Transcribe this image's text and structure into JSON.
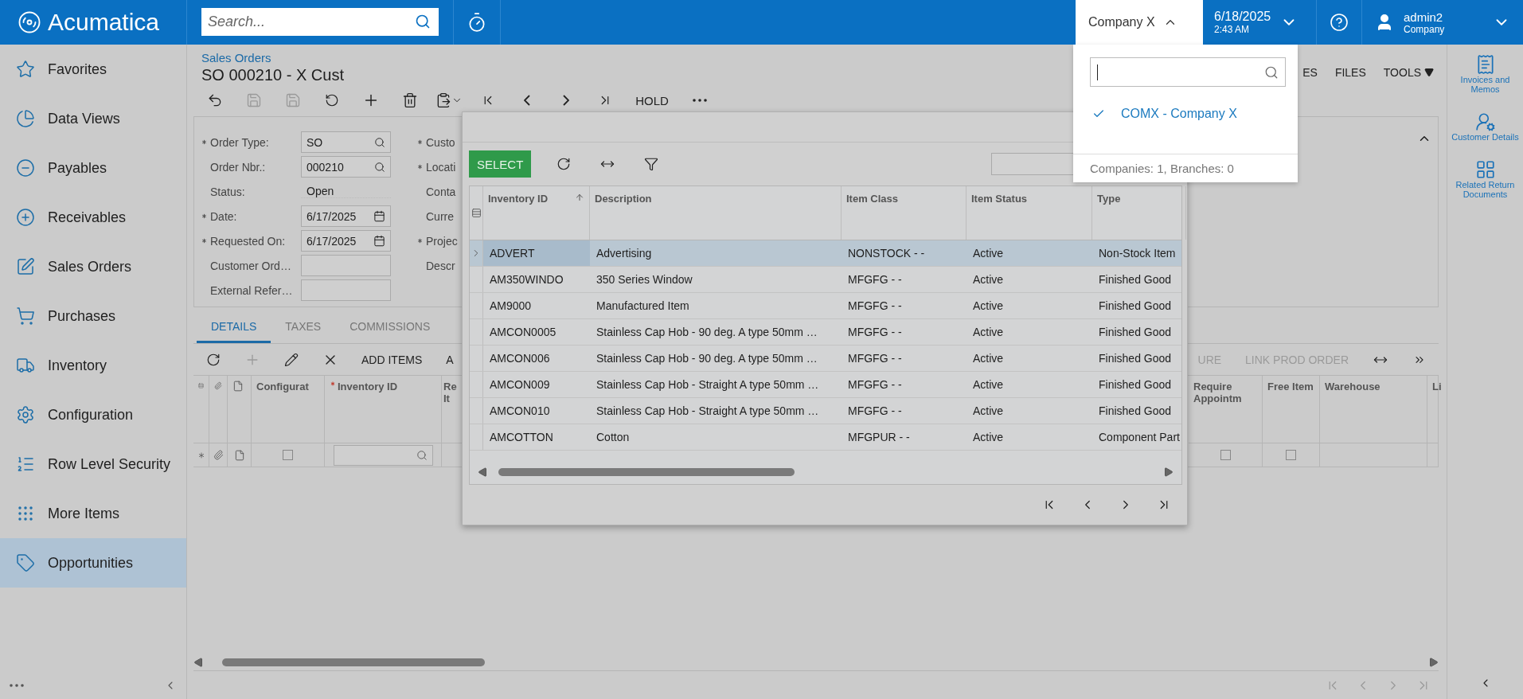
{
  "header": {
    "logo": "Acumatica",
    "search": {
      "placeholder": "Search..."
    },
    "company": {
      "label": "Company X",
      "expanded": true
    },
    "date": "6/18/2025",
    "time": "2:43 AM",
    "user": {
      "name": "admin2",
      "company": "Company"
    }
  },
  "sidebar": {
    "items": [
      {
        "label": "Favorites",
        "selected": false
      },
      {
        "label": "Data Views",
        "selected": false
      },
      {
        "label": "Payables",
        "selected": false
      },
      {
        "label": "Receivables",
        "selected": false
      },
      {
        "label": "Sales Orders",
        "selected": false
      },
      {
        "label": "Purchases",
        "selected": false
      },
      {
        "label": "Inventory",
        "selected": false
      },
      {
        "label": "Configuration",
        "selected": false
      },
      {
        "label": "Row Level Security",
        "selected": false
      },
      {
        "label": "More Items",
        "selected": false
      },
      {
        "label": "Opportunities",
        "selected": true
      }
    ]
  },
  "page": {
    "breadcrumb": "Sales Orders",
    "title": "SO 000210 - X Cust",
    "toolbar": {
      "hold": "HOLD"
    },
    "actions": [
      {
        "label": "ES",
        "kind": "plain"
      },
      {
        "label": "FILES",
        "kind": "plain"
      },
      {
        "label": "TOOLS",
        "kind": "menu"
      }
    ]
  },
  "form": {
    "fields": [
      {
        "label": "Order Type:",
        "required": true,
        "kind": "lookup",
        "value": "SO"
      },
      {
        "label": "Order Nbr.:",
        "required": false,
        "kind": "lookup",
        "value": "000210"
      },
      {
        "label": "Status:",
        "required": false,
        "kind": "text",
        "value": "Open"
      },
      {
        "label": "Date:",
        "required": true,
        "kind": "date",
        "value": "6/17/2025"
      },
      {
        "label": "Requested On:",
        "required": true,
        "kind": "date",
        "value": "6/17/2025"
      },
      {
        "label": "Customer Ord…",
        "required": false,
        "kind": "input"
      },
      {
        "label": "External Refer…",
        "required": false,
        "kind": "input"
      }
    ],
    "column_2": [
      {
        "label": "Custo",
        "required": true
      },
      {
        "label": "Locati",
        "required": true
      },
      {
        "label": "Conta",
        "required": false
      },
      {
        "label": "Curre",
        "required": false
      },
      {
        "label": "Projec",
        "required": true
      },
      {
        "label": "Descr",
        "required": false
      }
    ]
  },
  "tabs": [
    {
      "label": "DETAILS",
      "selected": true
    },
    {
      "label": "TAXES",
      "selected": false
    },
    {
      "label": "COMMISSIONS",
      "selected": false
    }
  ],
  "details": {
    "toolbar": [
      {
        "label": "ADD ITEMS",
        "disabled": false
      },
      {
        "label": "A",
        "disabled": false
      }
    ],
    "toolbar_right": [
      {
        "label": "URE",
        "disabled": true
      },
      {
        "label": "LINK PROD ORDER",
        "disabled": true
      }
    ],
    "columns_left": [
      {
        "label": "Configurat",
        "required": false
      },
      {
        "label": "Inventory ID",
        "required": true
      },
      {
        "label": "Re It",
        "required": false
      }
    ],
    "columns_right": [
      {
        "label": "Require Appointm"
      },
      {
        "label": "Free Item"
      },
      {
        "label": "Warehouse"
      },
      {
        "label": "Li"
      }
    ],
    "new_row": {
      "configurable_checked": false,
      "require_appointment_checked": false,
      "free_item_checked": false
    }
  },
  "dialog": {
    "select": "SELECT",
    "columns": [
      {
        "label": "Inventory ID",
        "sorted": true
      },
      {
        "label": "Description",
        "sorted": false
      },
      {
        "label": "Item Class",
        "sorted": false
      },
      {
        "label": "Item Status",
        "sorted": false
      },
      {
        "label": "Type",
        "sorted": false
      }
    ],
    "rows": [
      {
        "selected": true,
        "cells": [
          "ADVERT",
          "Advertising",
          "NONSTOCK - -",
          "Active",
          "Non-Stock Item"
        ]
      },
      {
        "selected": false,
        "cells": [
          "AM350WINDO",
          "350 Series Window",
          "MFGFG - -",
          "Active",
          "Finished Good"
        ]
      },
      {
        "selected": false,
        "cells": [
          "AM9000",
          "Manufactured Item",
          "MFGFG - -",
          "Active",
          "Finished Good"
        ]
      },
      {
        "selected": false,
        "cells": [
          "AMCON0005",
          "Stainless Cap Hob - 90 deg. A type 50mm …",
          "MFGFG - -",
          "Active",
          "Finished Good"
        ]
      },
      {
        "selected": false,
        "cells": [
          "AMCON006",
          "Stainless Cap Hob - 90 deg. A type 50mm …",
          "MFGFG - -",
          "Active",
          "Finished Good"
        ]
      },
      {
        "selected": false,
        "cells": [
          "AMCON009",
          "Stainless Cap Hob - Straight A type 50mm …",
          "MFGFG - -",
          "Active",
          "Finished Good"
        ]
      },
      {
        "selected": false,
        "cells": [
          "AMCON010",
          "Stainless Cap Hob - Straight A type 50mm …",
          "MFGFG - -",
          "Active",
          "Finished Good"
        ]
      },
      {
        "selected": false,
        "cells": [
          "AMCOTTON",
          "Cotton",
          "MFGPUR - -",
          "Active",
          "Component Part"
        ]
      }
    ]
  },
  "company_menu": {
    "options": [
      {
        "label": "COMX - Company X",
        "selected": true
      }
    ],
    "footer": "Companies: 1, Branches: 0"
  },
  "right_panel": [
    "Invoices and Memos",
    "Customer Details",
    "Related Return Documents"
  ]
}
